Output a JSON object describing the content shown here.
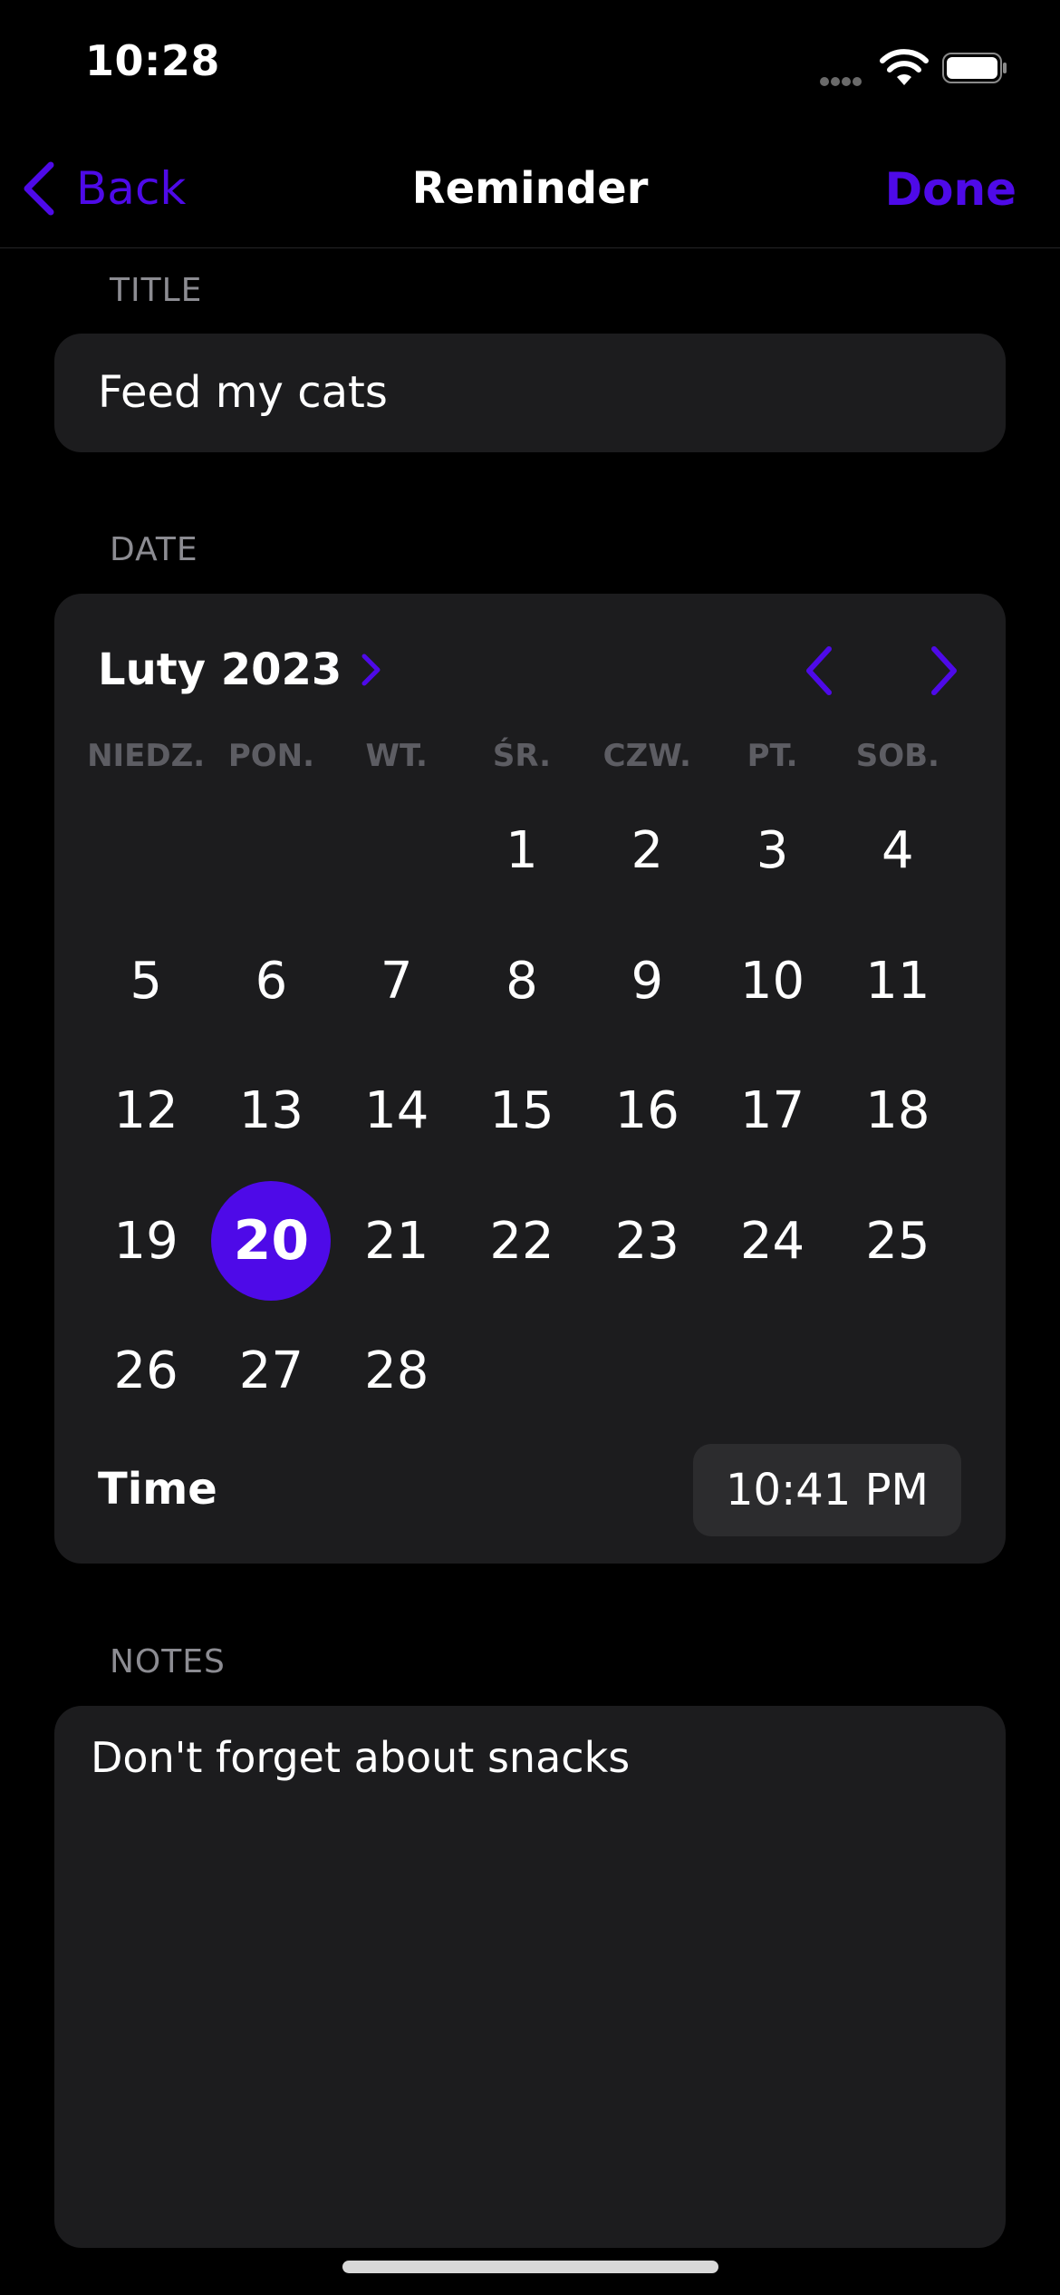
{
  "status_bar": {
    "time": "10:28"
  },
  "nav": {
    "back_label": "Back",
    "title": "Reminder",
    "done_label": "Done",
    "accent": "#4e0ae8"
  },
  "title_section": {
    "label": "TITLE",
    "value": "Feed my cats"
  },
  "date_section": {
    "label": "DATE",
    "month_label": "Luty 2023",
    "weekdays": [
      "NIEDZ.",
      "PON.",
      "WT.",
      "ŚR.",
      "CZW.",
      "PT.",
      "SOB."
    ],
    "first_weekday_index": 3,
    "days_in_month": 28,
    "selected_day": 20,
    "time_label": "Time",
    "time_value": "10:41 PM"
  },
  "notes_section": {
    "label": "NOTES",
    "value": "Don't forget about snacks"
  }
}
